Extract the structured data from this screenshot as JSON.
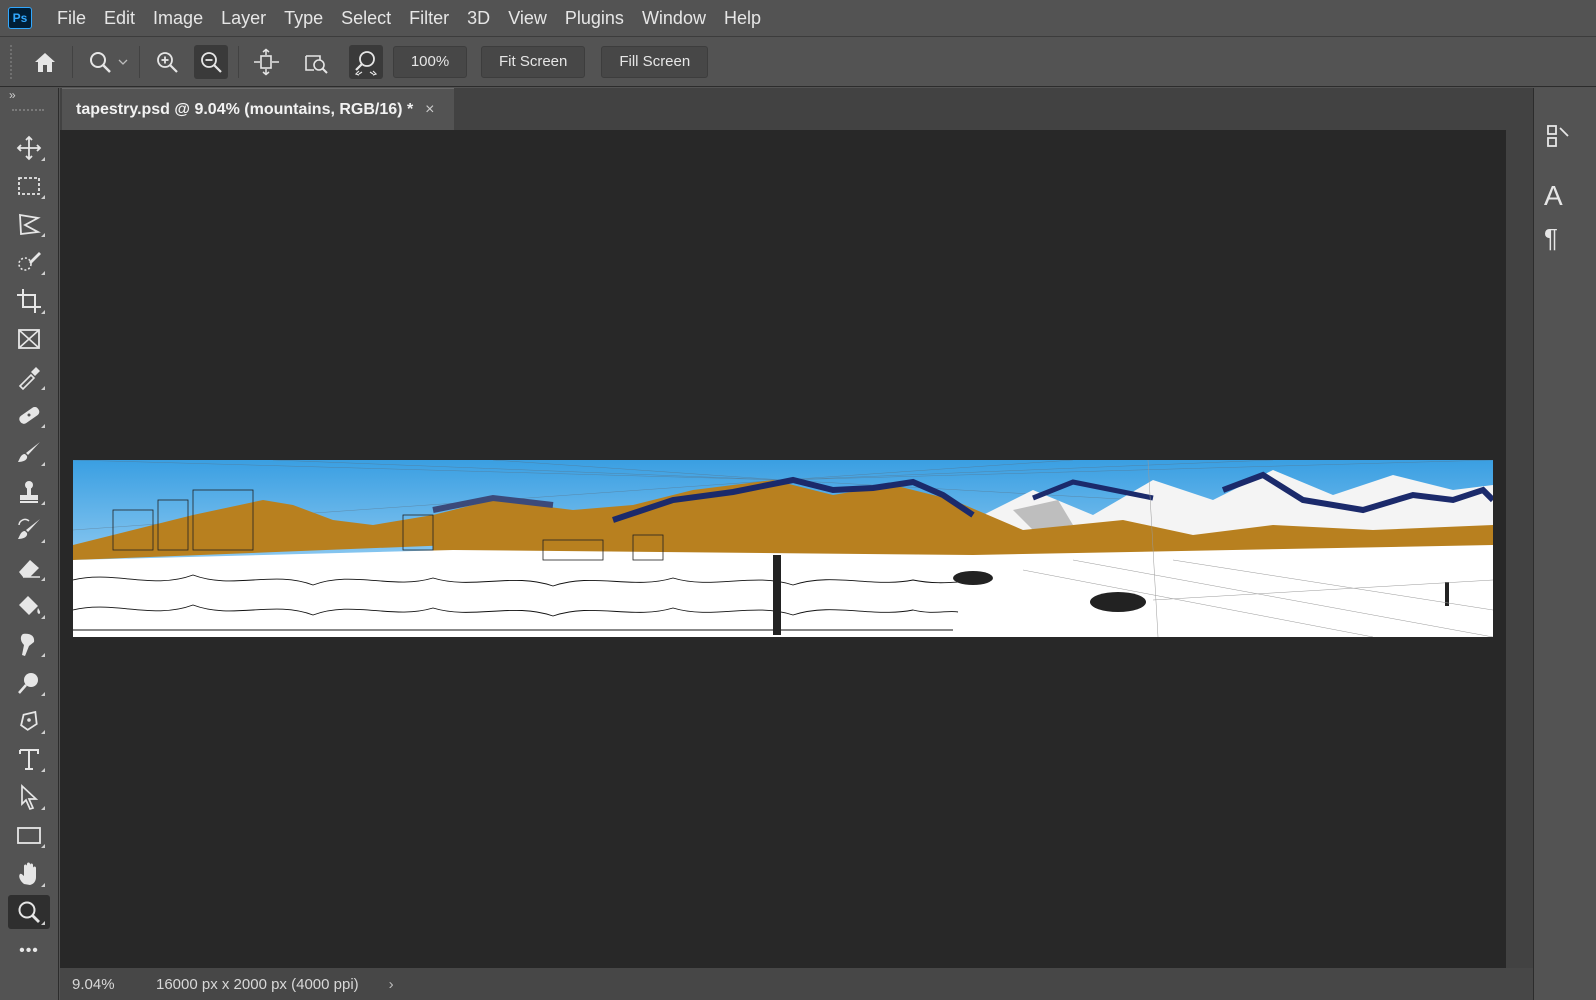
{
  "app": {
    "logo": "Ps"
  },
  "menu": [
    "File",
    "Edit",
    "Image",
    "Layer",
    "Type",
    "Select",
    "Filter",
    "3D",
    "View",
    "Plugins",
    "Window",
    "Help"
  ],
  "options": {
    "zoom_value": "100%",
    "fit_screen_label": "Fit Screen",
    "fill_screen_label": "Fill Screen"
  },
  "document": {
    "tab_title": "tapestry.psd @ 9.04% (mountains, RGB/16) *",
    "close_glyph": "×"
  },
  "status": {
    "zoom": "9.04%",
    "doc_info": "16000 px x 2000 px (4000 ppi)",
    "arrow": "›"
  },
  "toolbar": {
    "collapse_glyph": "»",
    "more_glyph": "•••",
    "tools": [
      "move-icon",
      "rect-marquee-icon",
      "lasso-icon",
      "quick-select-icon",
      "crop-icon",
      "frame-icon",
      "eyedropper-icon",
      "healing-brush-icon",
      "brush-icon",
      "clone-stamp-icon",
      "history-brush-icon",
      "eraser-icon",
      "paint-bucket-icon",
      "smudge-icon",
      "dodge-icon",
      "pen-icon",
      "type-icon",
      "path-select-icon",
      "rectangle-icon",
      "hand-icon",
      "zoom-icon"
    ],
    "active_tool": "zoom-icon"
  },
  "right_panel": {
    "type_glyph": "A",
    "paragraph_glyph": "¶"
  },
  "colors": {
    "ui_bg": "#535353",
    "canvas_bg": "#282828",
    "sky": "#4aa8e6",
    "ochre": "#b8801f",
    "navy": "#1b2a6b"
  }
}
